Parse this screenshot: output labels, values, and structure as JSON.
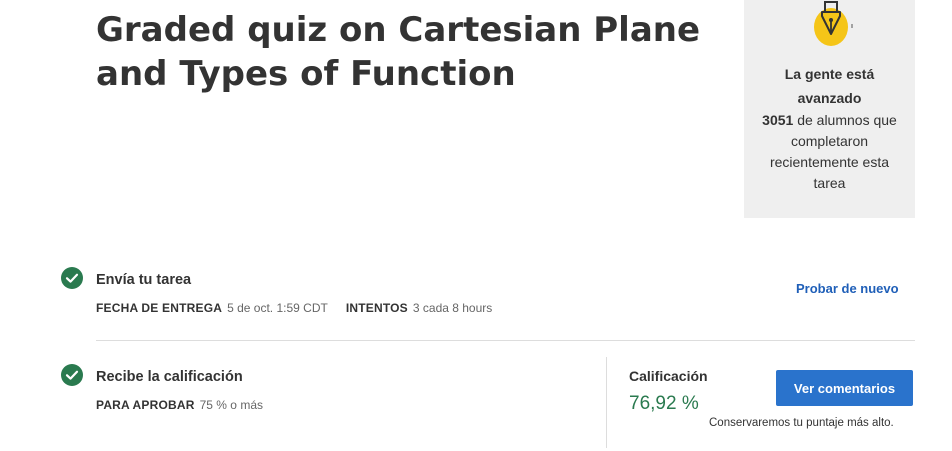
{
  "assignment": {
    "title": "Graded quiz on Cartesian Plane and Types of Function"
  },
  "promo": {
    "art_icon": "pen-nib-icon",
    "heading": "La gente está avanzado",
    "count": "3051",
    "body": "de alumnos que completaron recientemente esta tarea"
  },
  "submit_step": {
    "icon": "check-circle-icon",
    "title": "Envía tu tarea",
    "due_label": "FECHA DE ENTREGA",
    "due_value": "5 de oct. 1:59 CDT",
    "attempts_label": "INTENTOS",
    "attempts_value": "3 cada 8 hours",
    "retry_label": "Probar de nuevo"
  },
  "grade_step": {
    "icon": "check-circle-icon",
    "title": "Recibe la calificación",
    "pass_label": "PARA APROBAR",
    "pass_value": "75 % o más",
    "grade_label": "Calificación",
    "grade_value": "76,92 %",
    "feedback_label": "Ver comentarios",
    "keep_note": "Conservaremos tu puntaje más alto."
  },
  "colors": {
    "check_green": "#2a7a4f",
    "grade_green": "#2a7a4f",
    "link_blue": "#1f5fb8",
    "button_blue": "#2a73cc",
    "promo_bg": "#efefef",
    "art_yellow": "#f5c518"
  }
}
